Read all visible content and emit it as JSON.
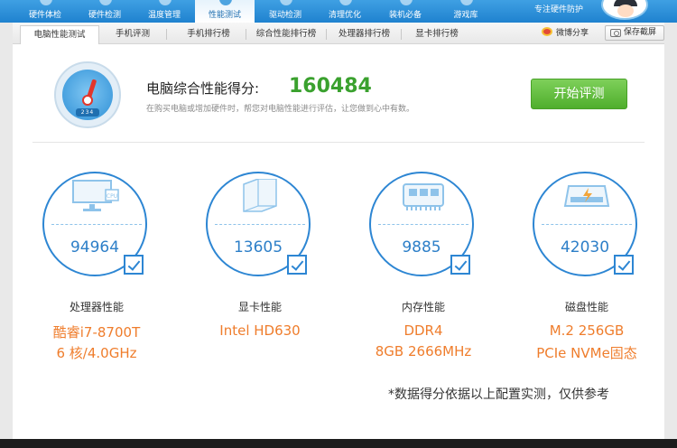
{
  "topnav": {
    "items": [
      {
        "label": "硬件体检"
      },
      {
        "label": "硬件检测"
      },
      {
        "label": "温度管理"
      },
      {
        "label": "性能测试"
      },
      {
        "label": "驱动检测"
      },
      {
        "label": "清理优化"
      },
      {
        "label": "装机必备"
      },
      {
        "label": "游戏库"
      }
    ],
    "active_index": 3,
    "brand": "专注硬件防护"
  },
  "subtabs": {
    "items": [
      {
        "label": "电脑性能测试"
      },
      {
        "label": "手机评测"
      },
      {
        "label": "手机排行榜"
      },
      {
        "label": "综合性能排行榜"
      },
      {
        "label": "处理器排行榜"
      },
      {
        "label": "显卡排行榜"
      }
    ],
    "active_index": 0,
    "share": "微博分享",
    "save": "保存截屏"
  },
  "overall": {
    "label": "电脑综合性能得分:",
    "score": "160484",
    "hint": "在购买电脑或增加硬件时，帮您对电脑性能进行评估，让您做到心中有数。",
    "gauge_counter": "234",
    "button": "开始评测"
  },
  "cards": [
    {
      "score": "94964",
      "title": "处理器性能",
      "line1": "酷睿i7-8700T",
      "line2": "6 核/4.0GHz",
      "icon": "monitor-cpu-icon"
    },
    {
      "score": "13605",
      "title": "显卡性能",
      "line1": "Intel HD630",
      "line2": "",
      "icon": "graphics-card-icon"
    },
    {
      "score": "9885",
      "title": "内存性能",
      "line1": "DDR4",
      "line2": "8GB 2666MHz",
      "icon": "memory-chip-icon"
    },
    {
      "score": "42030",
      "title": "磁盘性能",
      "line1": "M.2 256GB",
      "line2": "PCIe NVMe固态",
      "icon": "disk-drive-icon"
    }
  ],
  "footnote": "*数据得分依据以上配置实测，仅供参考",
  "colors": {
    "nav_blue": "#2a8ed9",
    "score_green": "#3aa12e",
    "accent_orange": "#ef7d2c",
    "circle_blue": "#2d86d3"
  }
}
